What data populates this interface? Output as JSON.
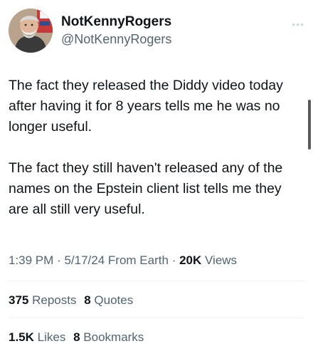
{
  "author": {
    "display_name": "NotKennyRogers",
    "handle": "@NotKennyRogers"
  },
  "more_icon": "more-dots-icon",
  "tweet": {
    "paragraphs": [
      "The fact they released the Diddy video today after having it for 8 years tells me he was no longer useful.",
      "The fact they still haven't released any of the names on the Epstein client list tells me they are all still very useful."
    ]
  },
  "meta": {
    "time": "1:39 PM",
    "separator": "·",
    "date": "5/17/24",
    "source": "From Earth",
    "views_count": "20K",
    "views_label": "Views"
  },
  "stats": {
    "reposts_count": "375",
    "reposts_label": "Reposts",
    "quotes_count": "8",
    "quotes_label": "Quotes",
    "likes_count": "1.5K",
    "likes_label": "Likes",
    "bookmarks_count": "8",
    "bookmarks_label": "Bookmarks"
  },
  "colors": {
    "text_primary": "#0f1419",
    "text_secondary": "#536471",
    "divider": "#eff3f4"
  }
}
